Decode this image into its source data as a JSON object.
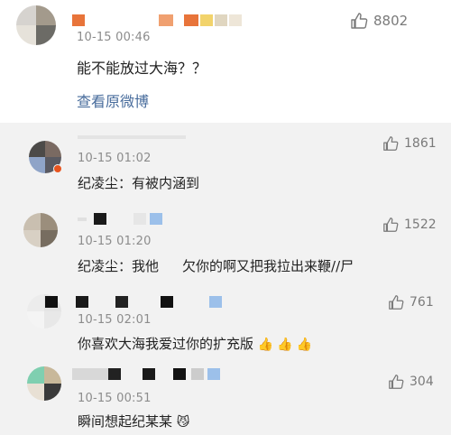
{
  "main_comment": {
    "time": "10-15 00:46",
    "text": "能不能放过大海？？",
    "view_original": "查看原微博",
    "likes": "8802"
  },
  "replies": [
    {
      "time": "10-15 01:02",
      "text": "纪凌尘：有被内涵到",
      "likes": "1861"
    },
    {
      "time": "10-15 01:20",
      "text_before": "纪凌尘：我他",
      "text_after": "欠你的啊又把我拉出来鞭//尸",
      "likes": "1522"
    },
    {
      "time": "10-15 02:01",
      "text": "你喜欢大海我爱过你的扩充版",
      "emojis": "👍👍👍",
      "likes": "761"
    },
    {
      "time": "10-15 00:51",
      "text": "瞬间想起纪某某",
      "emoji": "😼",
      "likes": "304"
    }
  ],
  "colors": {
    "link": "#486c9c",
    "time": "#8c8c8c",
    "like": "#7a7a7a",
    "background": "#f2f2f2"
  },
  "icons": {
    "like": "thumbs-up-icon"
  }
}
